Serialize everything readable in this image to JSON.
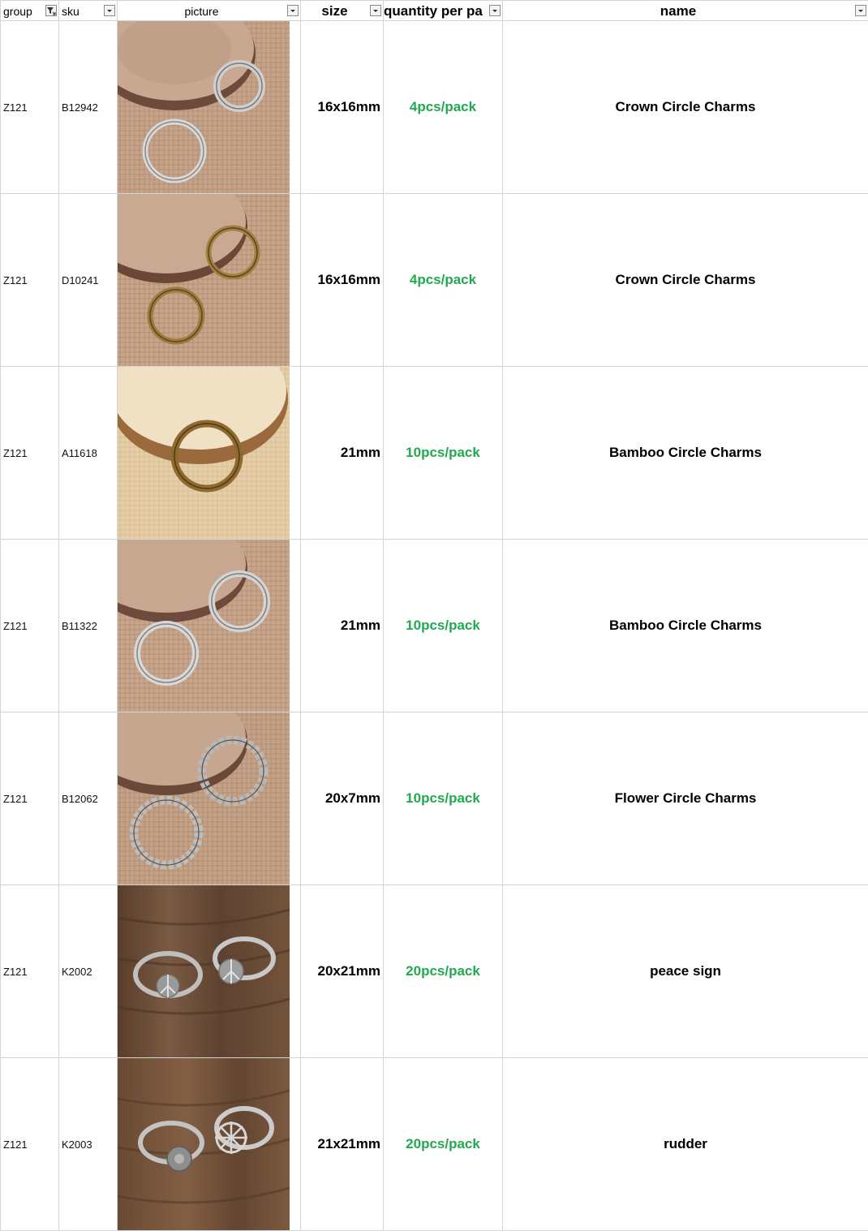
{
  "columns": {
    "group": "group",
    "sku": "sku",
    "picture": "picture",
    "size": "size",
    "quantity": "quantity per pa",
    "name": "name"
  },
  "colors": {
    "quantity_text": "#22a94f",
    "gridline": "#d4d4d4"
  },
  "rows": [
    {
      "group": "Z121",
      "sku": "B12942",
      "size": "16x16mm",
      "quantity": "4pcs/pack",
      "name": "Crown Circle Charms",
      "picture": "silver crown circle charms on burlap with wood slice"
    },
    {
      "group": "Z121",
      "sku": "D10241",
      "size": "16x16mm",
      "quantity": "4pcs/pack",
      "name": "Crown Circle Charms",
      "picture": "bronze crown circle charms on burlap with wood slice"
    },
    {
      "group": "Z121",
      "sku": "A11618",
      "size": "21mm",
      "quantity": "10pcs/pack",
      "name": "Bamboo Circle Charms",
      "picture": "bronze bamboo circle charm on burlap with wood slice"
    },
    {
      "group": "Z121",
      "sku": "B11322",
      "size": "21mm",
      "quantity": "10pcs/pack",
      "name": "Bamboo Circle Charms",
      "picture": "silver bamboo circle charms on burlap with wood slice"
    },
    {
      "group": "Z121",
      "sku": "B12062",
      "size": "20x7mm",
      "quantity": "10pcs/pack",
      "name": "Flower Circle Charms",
      "picture": "silver flower circle charms on burlap with wood slice"
    },
    {
      "group": "Z121",
      "sku": "K2002",
      "size": "20x21mm",
      "quantity": "20pcs/pack",
      "name": "peace sign",
      "picture": "silver peace sign rings on dark wood"
    },
    {
      "group": "Z121",
      "sku": "K2003",
      "size": "21x21mm",
      "quantity": "20pcs/pack",
      "name": "rudder",
      "picture": "silver rudder rings on dark wood"
    }
  ]
}
